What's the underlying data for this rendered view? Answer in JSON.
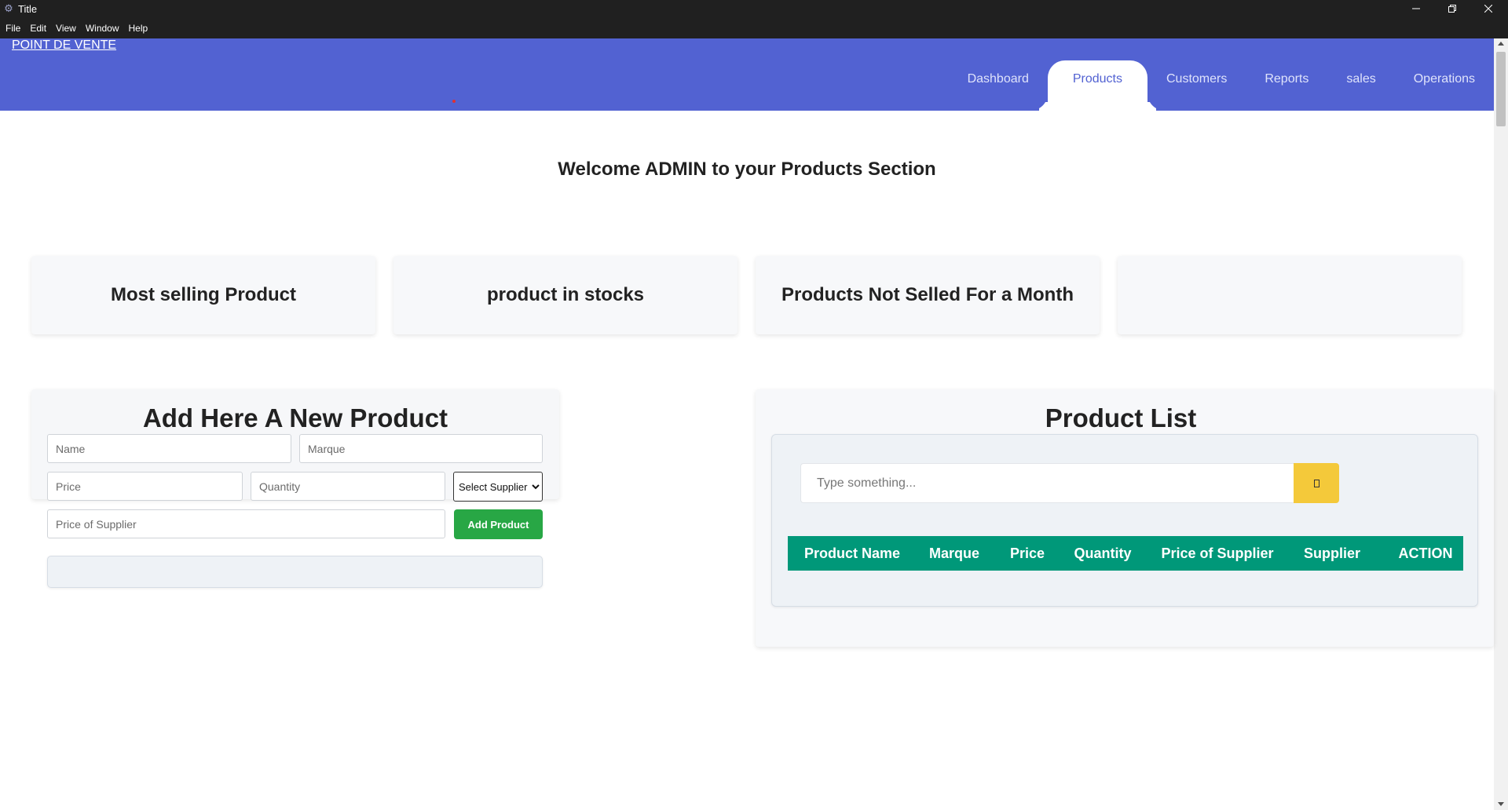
{
  "window": {
    "title": "Title",
    "menu": [
      "File",
      "Edit",
      "View",
      "Window",
      "Help"
    ]
  },
  "header": {
    "brand": "POINT DE VENTE",
    "tabs": [
      "Dashboard",
      "Products",
      "Customers",
      "Reports",
      "sales",
      "Operations"
    ],
    "active_tab": "Products",
    "color": "#5262d2"
  },
  "welcome": "Welcome ADMIN to your Products Section",
  "stats": [
    {
      "label": "Most selling Product"
    },
    {
      "label": "product in stocks"
    },
    {
      "label": "Products Not Selled For a Month"
    },
    {
      "label": ""
    }
  ],
  "add_form": {
    "title": "Add Here A New Product",
    "name_placeholder": "Name",
    "marque_placeholder": "Marque",
    "price_placeholder": "Price",
    "quantity_placeholder": "Quantity",
    "supplier_select": "Select Supplier",
    "price_supplier_placeholder": "Price of Supplier",
    "submit_label": "Add Product",
    "submit_color": "#28a745"
  },
  "product_list": {
    "title": "Product List",
    "search_placeholder": "Type something...",
    "search_icon": "search-icon",
    "search_button_color": "#f4c93a",
    "header_color": "#009879",
    "columns": [
      "Product Name",
      "Marque",
      "Price",
      "Quantity",
      "Price of Supplier",
      "Supplier",
      "ACTION"
    ]
  }
}
